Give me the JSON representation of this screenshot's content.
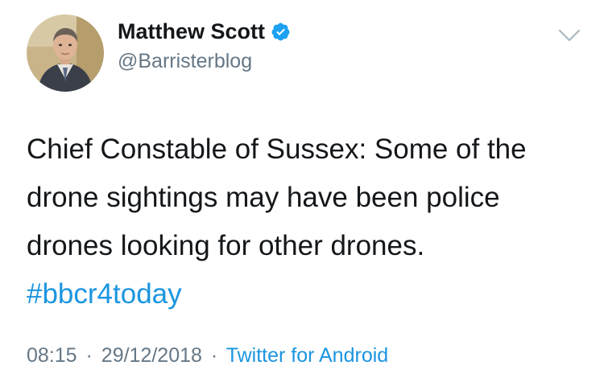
{
  "tweet": {
    "author": {
      "display_name": "Matthew Scott",
      "handle": "@Barristerblog",
      "verified": true,
      "avatar_icon": "profile-photo",
      "verified_icon": "verified-badge-icon"
    },
    "text_lines": [
      "Chief Constable of Sussex: Some of the",
      "drone sightings may have been police",
      "drones looking for other drones."
    ],
    "hashtag": "#bbcr4today",
    "meta": {
      "time": "08:15",
      "separator": "·",
      "date": "29/12/2018",
      "source": "Twitter for Android"
    },
    "menu_icon": "chevron-down-icon"
  },
  "colors": {
    "text": "#14171a",
    "secondary": "#657786",
    "link": "#1b95e0",
    "verified_badge": "#1da1f2",
    "background": "#ffffff"
  }
}
